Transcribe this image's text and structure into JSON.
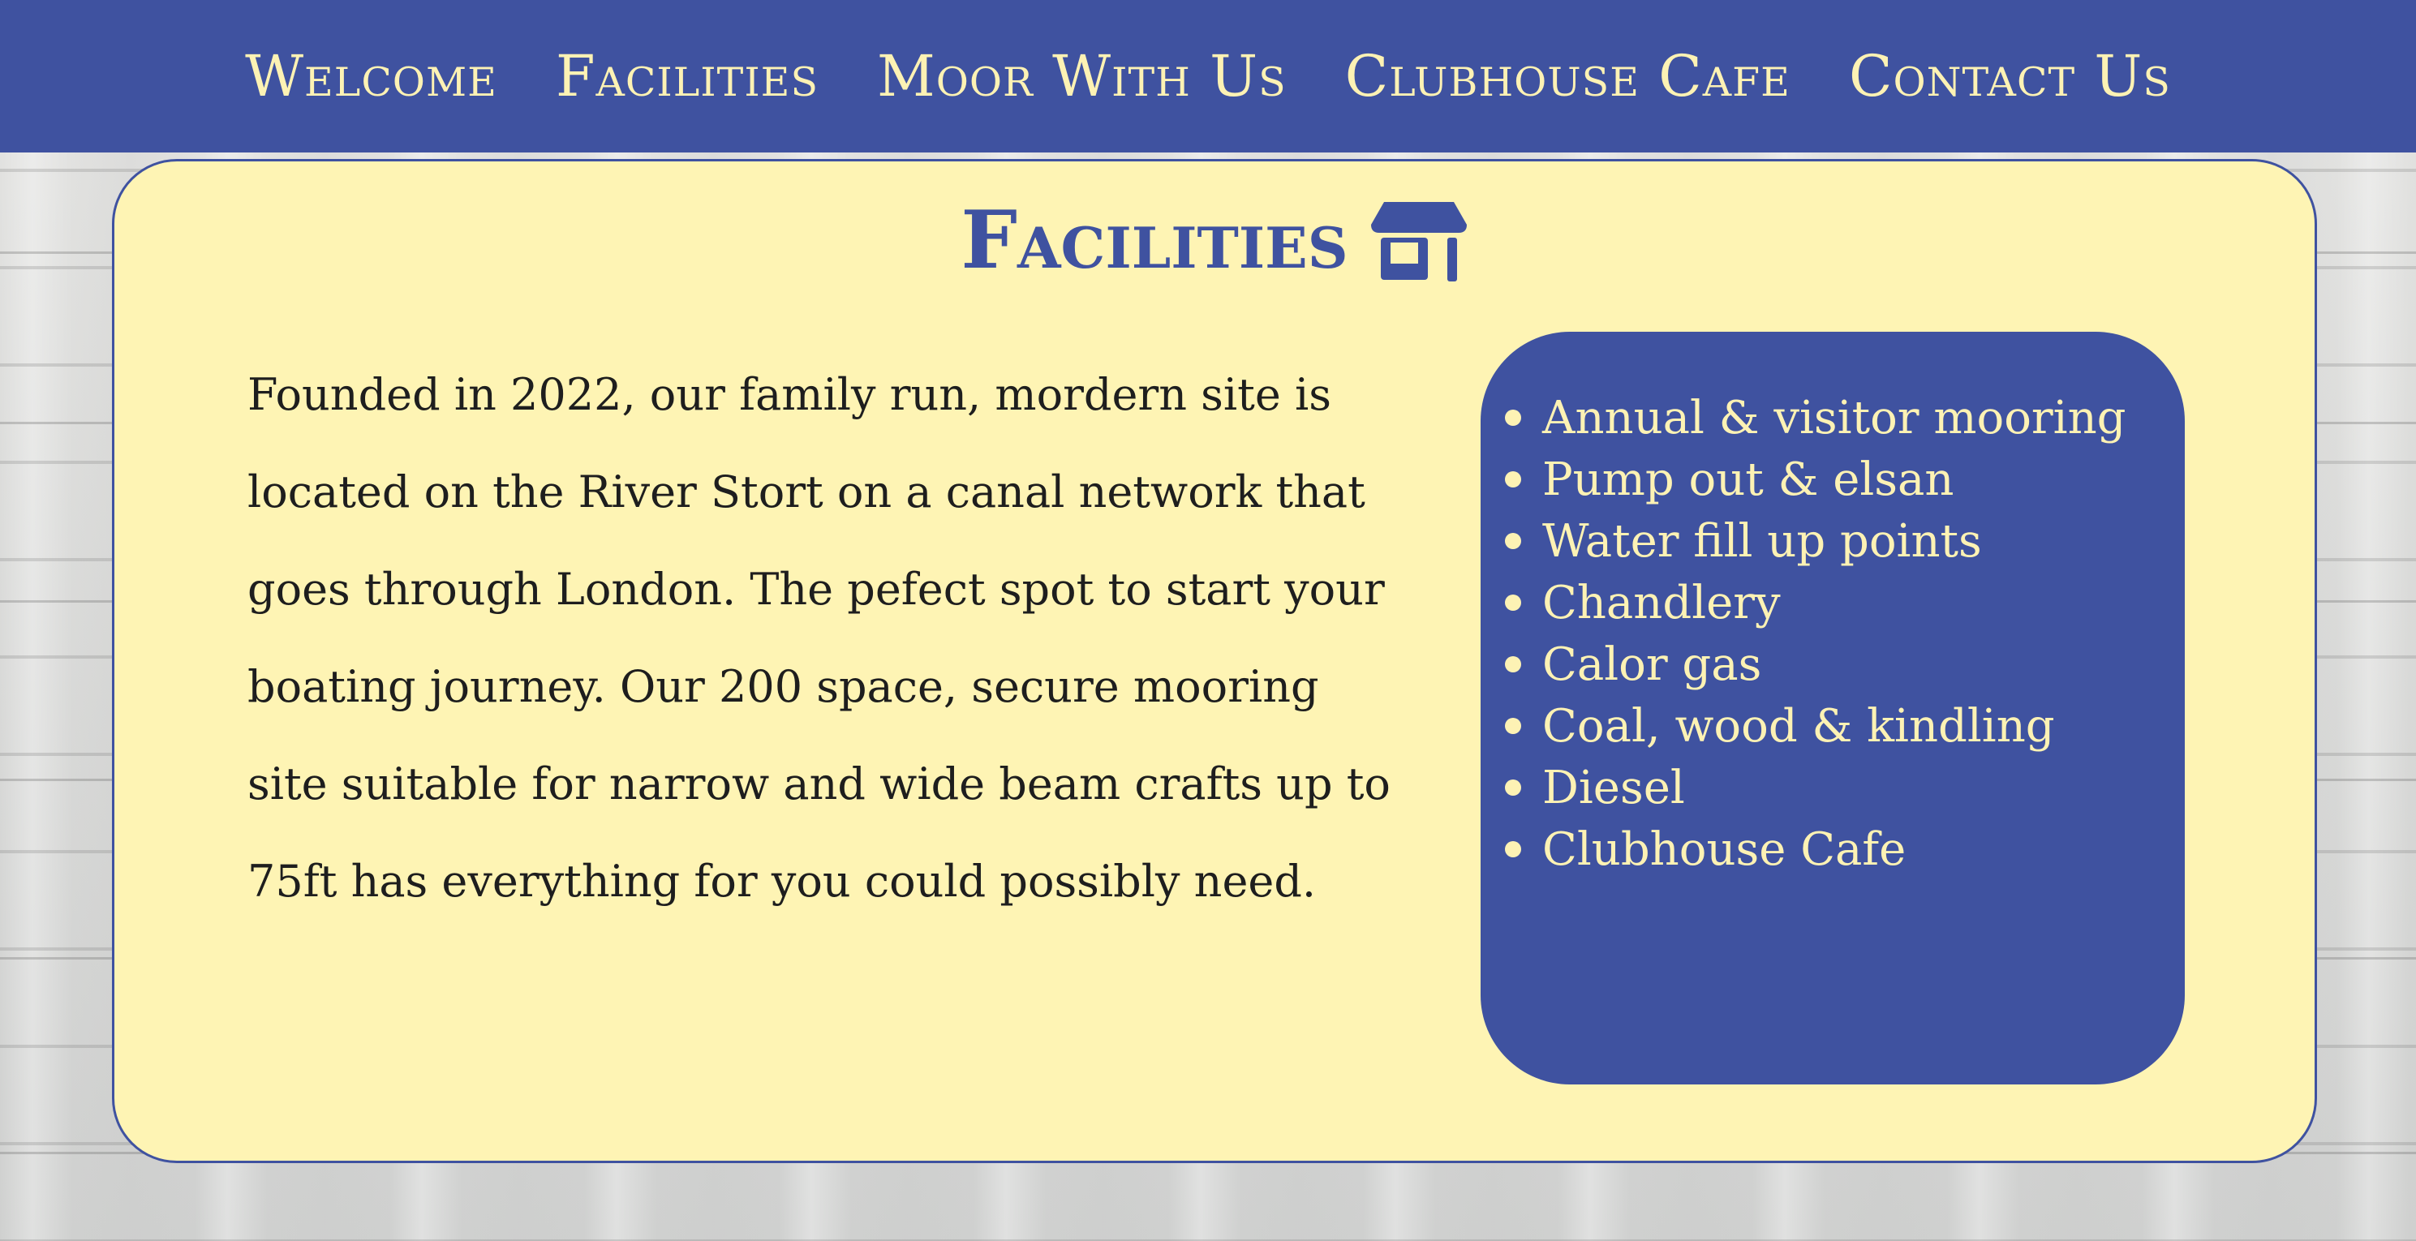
{
  "nav": {
    "items": [
      "Welcome",
      "Facilities",
      "Moor With Us",
      "Clubhouse Cafe",
      "Contact Us"
    ]
  },
  "facilities": {
    "title": "Facilities",
    "icon": "store-icon",
    "description": "Founded in 2022, our family run, mordern site is located on the River Stort on a canal network that goes through London. The pefect spot to start your boating journey. Our 200 space, secure mooring site suitable for narrow and wide beam crafts up to 75ft has everything for you could possibly need.",
    "list": [
      "Annual & visitor mooring",
      "Pump out & elsan",
      "Water fill up points",
      "Chandlery",
      "Calor gas",
      "Coal, wood & kindling",
      "Diesel",
      "Clubhouse Cafe"
    ]
  },
  "colors": {
    "primary": "#3f52a0",
    "cream": "#fef4b4",
    "nav_text": "#fdf2b4",
    "body_text": "#1e1e1e"
  }
}
